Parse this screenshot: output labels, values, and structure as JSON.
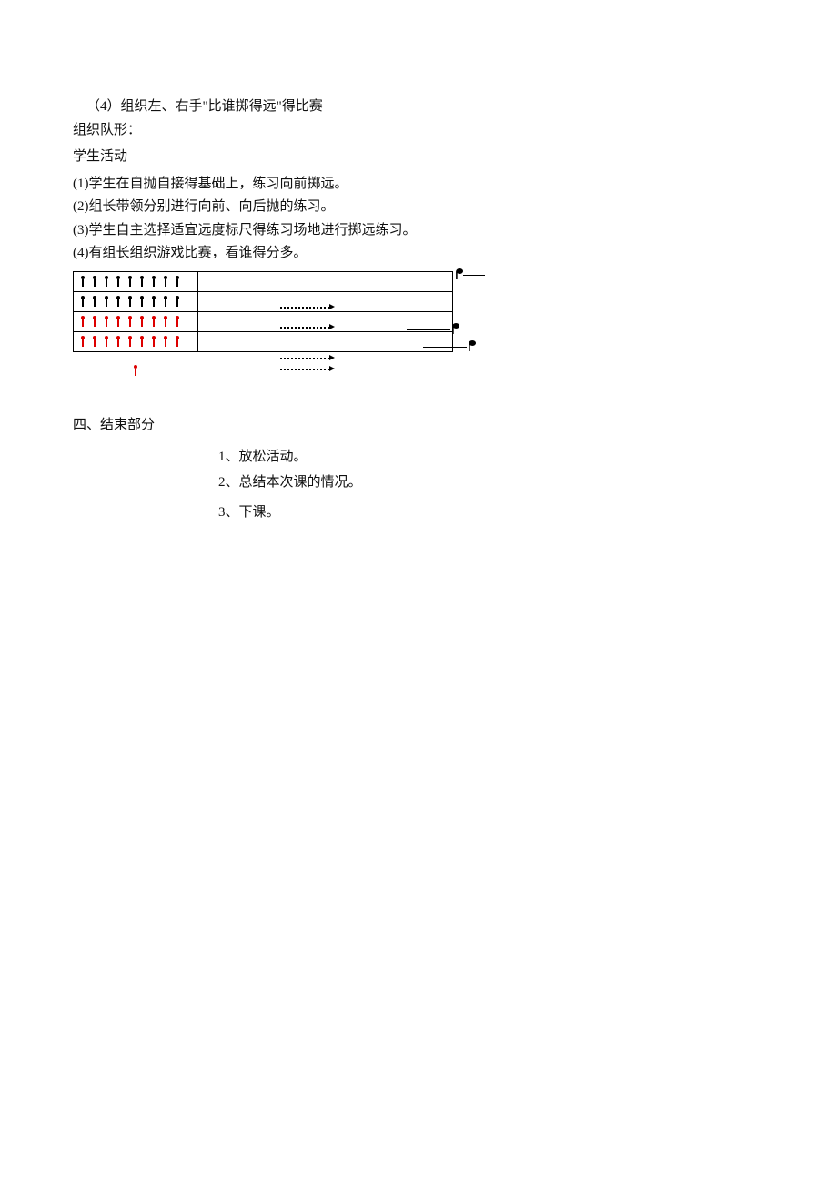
{
  "intro": {
    "line4": "（4）组织左、右手\"比谁掷得远\"得比赛",
    "formation_label": "组织队形：",
    "student_activity_heading": "学生活动"
  },
  "steps": {
    "s1": "(1)学生在自抛自接得基础上，练习向前掷远。",
    "s2": "(2)组长带领分别进行向前、向后抛的练习。",
    "s3": "(3)学生自主选择适宜远度标尺得练习场地进行掷远练习。",
    "s4": "(4)有组长组织游戏比赛，看谁得分多。"
  },
  "diagram": {
    "row_person_count": 9,
    "top_rows_color": "black",
    "bottom_rows_color": "red"
  },
  "section4": {
    "heading": "四、结束部分",
    "items": {
      "i1": "1、放松活动。",
      "i2": "2、总结本次课的情况。",
      "i3": "3、下课。"
    }
  }
}
